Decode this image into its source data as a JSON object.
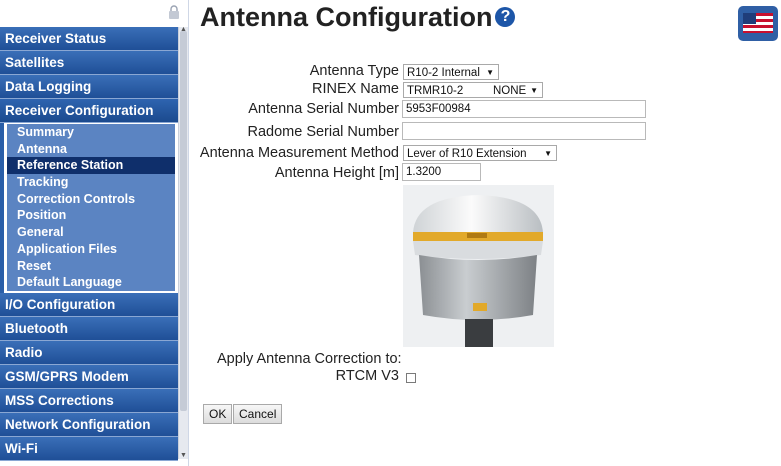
{
  "page": {
    "title": "Antenna Configuration",
    "help_icon": "help-icon"
  },
  "sidebar": {
    "top_items": [
      {
        "label": "Receiver Status"
      },
      {
        "label": "Satellites"
      },
      {
        "label": "Data Logging"
      },
      {
        "label": "Receiver Configuration"
      }
    ],
    "sub_items": [
      {
        "label": "Summary"
      },
      {
        "label": "Antenna"
      },
      {
        "label": "Reference Station"
      },
      {
        "label": "Tracking"
      },
      {
        "label": "Correction Controls"
      },
      {
        "label": "Position"
      },
      {
        "label": "General"
      },
      {
        "label": "Application Files"
      },
      {
        "label": "Reset"
      },
      {
        "label": "Default Language"
      }
    ],
    "bottom_items": [
      {
        "label": "I/O Configuration"
      },
      {
        "label": "Bluetooth"
      },
      {
        "label": "Radio"
      },
      {
        "label": "GSM/GPRS Modem"
      },
      {
        "label": "MSS Corrections"
      },
      {
        "label": "Network Configuration"
      },
      {
        "label": "Wi-Fi"
      }
    ]
  },
  "form": {
    "antenna_type": {
      "label": "Antenna Type",
      "value": "R10-2 Internal"
    },
    "rinex_name": {
      "label": "RINEX Name",
      "value": "TRMR10-2",
      "value2": "NONE"
    },
    "antenna_serial": {
      "label": "Antenna Serial Number",
      "value": "5953F00984"
    },
    "radome_serial": {
      "label": "Radome Serial Number",
      "value": ""
    },
    "measurement_method": {
      "label": "Antenna Measurement Method",
      "value": "Lever of R10 Extension"
    },
    "antenna_height": {
      "label": "Antenna Height [m]",
      "value": "1.3200"
    },
    "apply_correction_label": "Apply Antenna Correction to:",
    "rtcm_v3_label": "RTCM V3"
  },
  "buttons": {
    "ok": "OK",
    "cancel": "Cancel"
  },
  "colors": {
    "menu_blue": "#2a5ea8",
    "selected_sub": "#0f2f6b"
  }
}
